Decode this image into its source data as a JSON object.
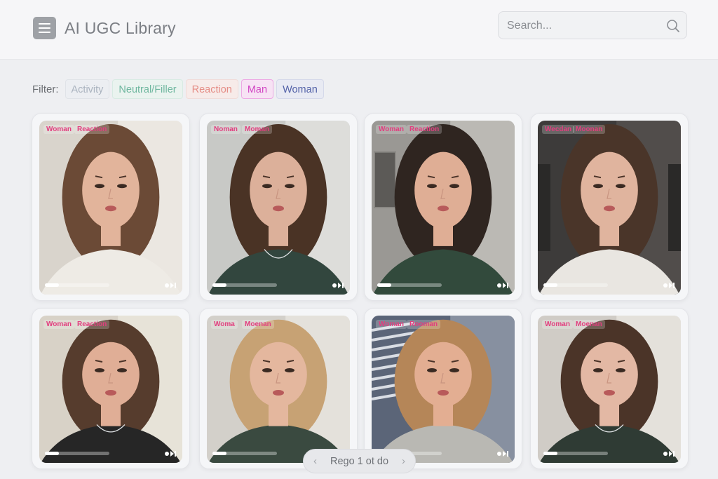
{
  "header": {
    "title": "AI UGC Library",
    "search_placeholder": "Search..."
  },
  "filters": {
    "label": "Filter:",
    "chips": [
      {
        "label": "Activity",
        "color": "#aab3bf",
        "bg": "#eceef2",
        "border": "#e0e3e8"
      },
      {
        "label": "Neutral/Filler",
        "color": "#6fb79f",
        "bg": "#eaf3ef",
        "border": "#d8ebe3"
      },
      {
        "label": "Reaction",
        "color": "#e58d86",
        "bg": "#f7ebe9",
        "border": "#f1dcd9"
      },
      {
        "label": "Man",
        "color": "#d145c3",
        "bg": "#f7e2f4",
        "border": "#eda9e4"
      },
      {
        "label": "Woman",
        "color": "#5362a8",
        "bg": "#e8eaf3",
        "border": "#d5d9ea"
      }
    ]
  },
  "cards": [
    {
      "tags": [
        "Woman",
        "Reaction"
      ],
      "progress": 0.22,
      "scene": {
        "bg": "#d9d4cc",
        "bg2": "#f2efe9",
        "hair": "#6b4a36",
        "skin": "#e2b49b",
        "shirt": "#eeebe5",
        "extra": "headband"
      }
    },
    {
      "tags": [
        "Noman",
        "Moman"
      ],
      "progress": 0.22,
      "scene": {
        "bg": "#c8c9c6",
        "bg2": "#e6e6e3",
        "hair": "#4a3325",
        "skin": "#dcb09a",
        "shirt": "#32463e",
        "extra": "necklace"
      }
    },
    {
      "tags": [
        "Woman",
        "Reaction"
      ],
      "progress": 0.22,
      "scene": {
        "bg": "#9a9894",
        "bg2": "#c9c7c2",
        "hair": "#2f2520",
        "skin": "#dfae95",
        "shirt": "#324a3c",
        "extra": "frame"
      }
    },
    {
      "tags": [
        "Wecdan",
        "Moonan"
      ],
      "progress": 0.22,
      "scene": {
        "bg": "#3d3b3a",
        "bg2": "#5a5653",
        "hair": "#4a3529",
        "skin": "#e0b49e",
        "shirt": "#e9e6e1",
        "extra": "car"
      }
    },
    {
      "tags": [
        "Woman",
        "Reaction"
      ],
      "progress": 0.22,
      "scene": {
        "bg": "#d8d2c7",
        "bg2": "#eee9df",
        "hair": "#563c2d",
        "skin": "#e0ae96",
        "shirt": "#262626",
        "extra": "necklace"
      }
    },
    {
      "tags": [
        "Woma",
        "Moenan"
      ],
      "progress": 0.22,
      "scene": {
        "bg": "#d3d0ca",
        "bg2": "#ebe8e2",
        "hair": "#c7a274",
        "skin": "#e4b79e",
        "shirt": "#3a4a40",
        "extra": "none"
      }
    },
    {
      "tags": [
        "Woman",
        "Rooman"
      ],
      "progress": 0.22,
      "scene": {
        "bg": "#5b6578",
        "bg2": "#9aa2b1",
        "hair": "#b58658",
        "skin": "#e3ae92",
        "shirt": "#b9b8b3",
        "extra": "stripes"
      }
    },
    {
      "tags": [
        "Woman",
        "Moenan"
      ],
      "progress": 0.22,
      "scene": {
        "bg": "#d0ccc6",
        "bg2": "#ece9e4",
        "hair": "#4b3428",
        "skin": "#e3b8a4",
        "shirt": "#2f3b34",
        "extra": "necklace"
      }
    }
  ],
  "pagination": {
    "label": "Rego 1 ot do",
    "prev_icon": "chevron-left-icon",
    "next_icon": "chevron-right-icon"
  }
}
